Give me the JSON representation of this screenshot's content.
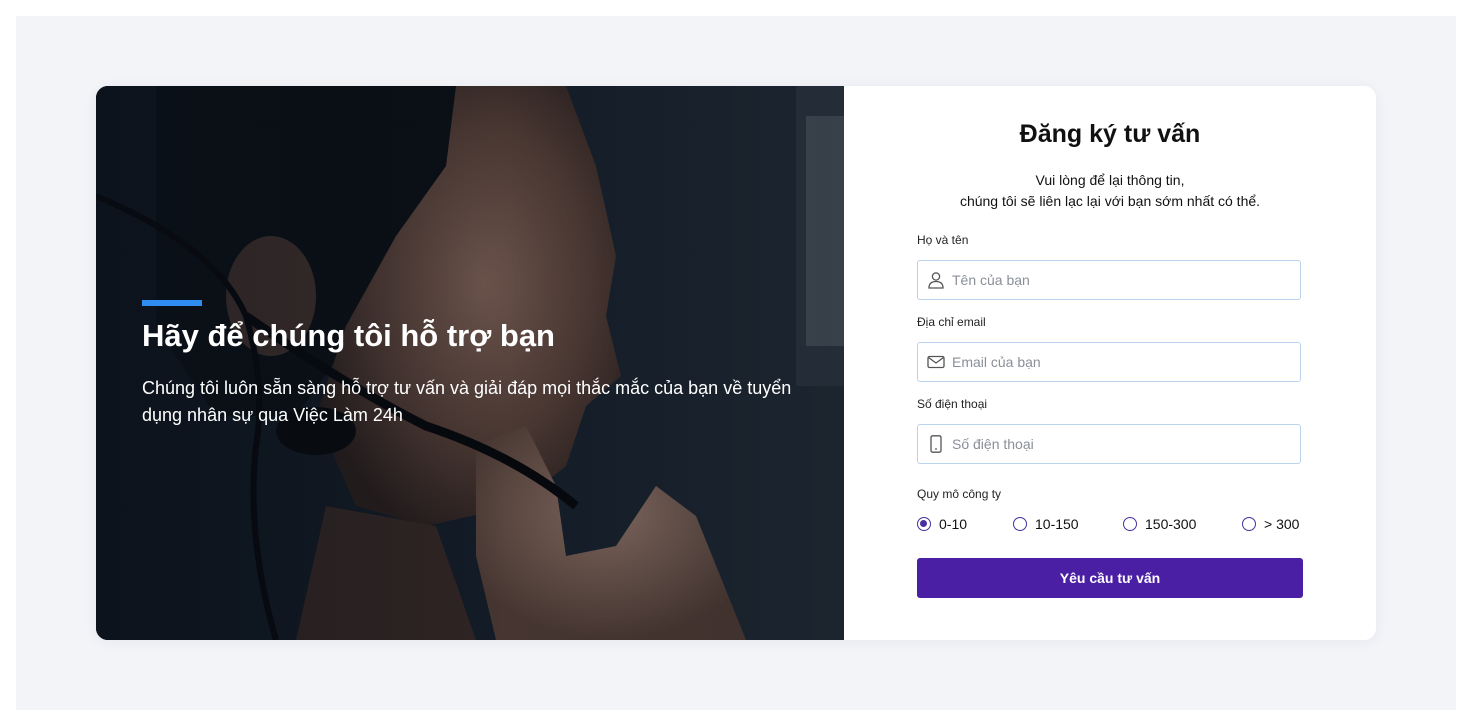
{
  "hero": {
    "title": "Hãy để chúng tôi hỗ trợ bạn",
    "description": "Chúng tôi luôn sẵn sàng hỗ trợ tư vấn và giải đáp mọi thắc mắc của bạn về tuyển dụng nhân sự qua Việc Làm 24h",
    "accent_color": "#2f8cf0"
  },
  "form": {
    "title": "Đăng ký tư vấn",
    "subtitle_line1": "Vui lòng để lại thông tin,",
    "subtitle_line2": "chúng tôi sẽ liên lạc lại với bạn sớm nhất có thể.",
    "fields": [
      {
        "label": "Họ và tên",
        "placeholder": "Tên của bạn",
        "value": "",
        "icon": "user-icon"
      },
      {
        "label": "Địa chỉ email",
        "placeholder": "Email của bạn",
        "value": "",
        "icon": "mail-icon"
      },
      {
        "label": "Số điện thoại",
        "placeholder": "Số điện thoại",
        "value": "",
        "icon": "phone-icon"
      }
    ],
    "company_size": {
      "label": "Quy mô công ty",
      "options": [
        "0-10",
        "10-150",
        "150-300",
        "> 300"
      ],
      "selected": "0-10"
    },
    "submit_label": "Yêu cầu tư vấn",
    "button_color": "#4a1fa3"
  },
  "colors": {
    "page_background": "#f3f4f8",
    "field_border": "#b9d4ec",
    "radio_color": "#4a2fa0"
  }
}
